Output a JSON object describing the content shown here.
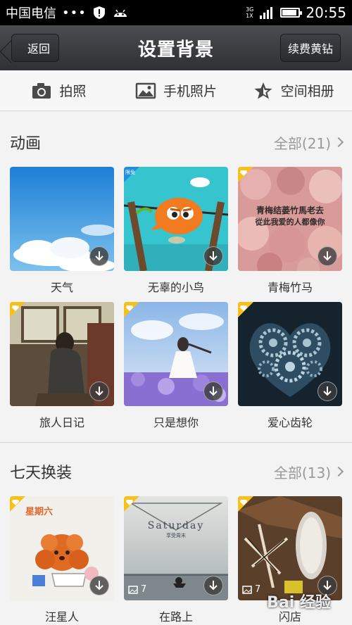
{
  "status_bar": {
    "carrier": "中国电信",
    "dots": "•••",
    "network_top": "3G",
    "network_bottom": "1X",
    "time": "20:55",
    "battery_level": 0.9
  },
  "header": {
    "back_label": "返回",
    "title": "设置背景",
    "renew_label": "续费黄钻"
  },
  "actions": [
    {
      "label": "拍照",
      "icon": "camera-icon"
    },
    {
      "label": "手机照片",
      "icon": "image-icon"
    },
    {
      "label": "空间相册",
      "icon": "star-icon"
    }
  ],
  "sections": [
    {
      "title": "动画",
      "more": "全部(21)",
      "items": [
        {
          "label": "天气",
          "badge": ""
        },
        {
          "label": "无辜的小鸟",
          "badge": "限免"
        },
        {
          "label": "青梅竹马",
          "badge": "diamond",
          "art_text_1": "青梅结蒌竹馬老去",
          "art_text_2": "從此我爱的人都像你"
        },
        {
          "label": "旅人日记",
          "badge": "diamond"
        },
        {
          "label": "只是想你",
          "badge": "diamond"
        },
        {
          "label": "爱心齿轮",
          "badge": "diamond"
        }
      ]
    },
    {
      "title": "七天换装",
      "more": "全部(13)",
      "items": [
        {
          "label": "汪星人",
          "badge": "diamond",
          "art_text": "星期六"
        },
        {
          "label": "在路上",
          "badge": "diamond",
          "count": "7",
          "art_text_1": "Saturday",
          "art_text_2": "享受周末"
        },
        {
          "label": "闪店",
          "badge": "diamond",
          "count": "7"
        }
      ]
    }
  ],
  "watermark": "Bai 经验"
}
